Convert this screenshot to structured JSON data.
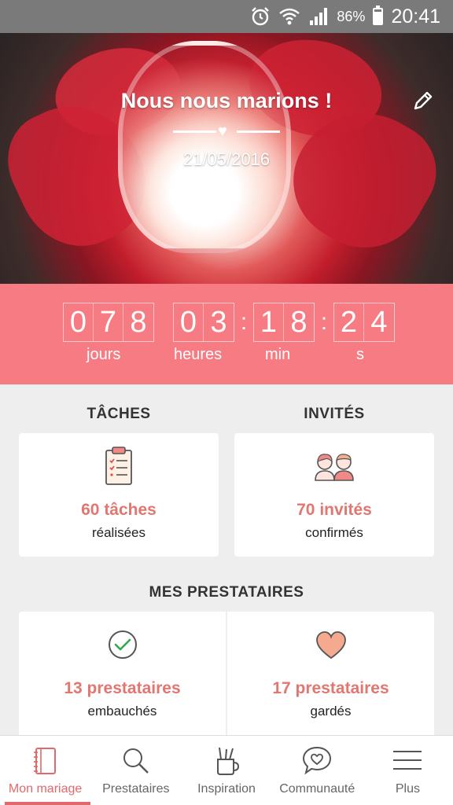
{
  "status_bar": {
    "battery": "86%",
    "battery_level": 0.86,
    "time": "20:41"
  },
  "hero": {
    "title": "Nous nous marions !",
    "date": "21/05/2016"
  },
  "countdown": {
    "days": [
      "0",
      "7",
      "8"
    ],
    "hours": [
      "0",
      "3"
    ],
    "minutes": [
      "1",
      "8"
    ],
    "seconds": [
      "2",
      "4"
    ],
    "labels": {
      "days": "jours",
      "hours": "heures",
      "minutes": "min",
      "seconds": "s"
    }
  },
  "tasks": {
    "section_title": "TÂCHES",
    "value": "60 tâches",
    "sub": "réalisées"
  },
  "guests": {
    "section_title": "INVITÉS",
    "value": "70 invités",
    "sub": "confirmés"
  },
  "vendors": {
    "section_title": "MES PRESTATAIRES",
    "hired": {
      "value": "13 prestataires",
      "sub": "embauchés"
    },
    "saved": {
      "value": "17 prestataires",
      "sub": "gardés"
    }
  },
  "nav": [
    {
      "label": "Mon mariage",
      "icon": "notebook-icon",
      "active": true
    },
    {
      "label": "Prestataires",
      "icon": "search-icon"
    },
    {
      "label": "Inspiration",
      "icon": "pencil-cup-icon"
    },
    {
      "label": "Communauté",
      "icon": "chat-heart-icon"
    },
    {
      "label": "Plus",
      "icon": "menu-icon"
    }
  ],
  "colors": {
    "accent": "#f77b82",
    "accent_text": "#e27670",
    "nav_active": "#e2686c"
  }
}
